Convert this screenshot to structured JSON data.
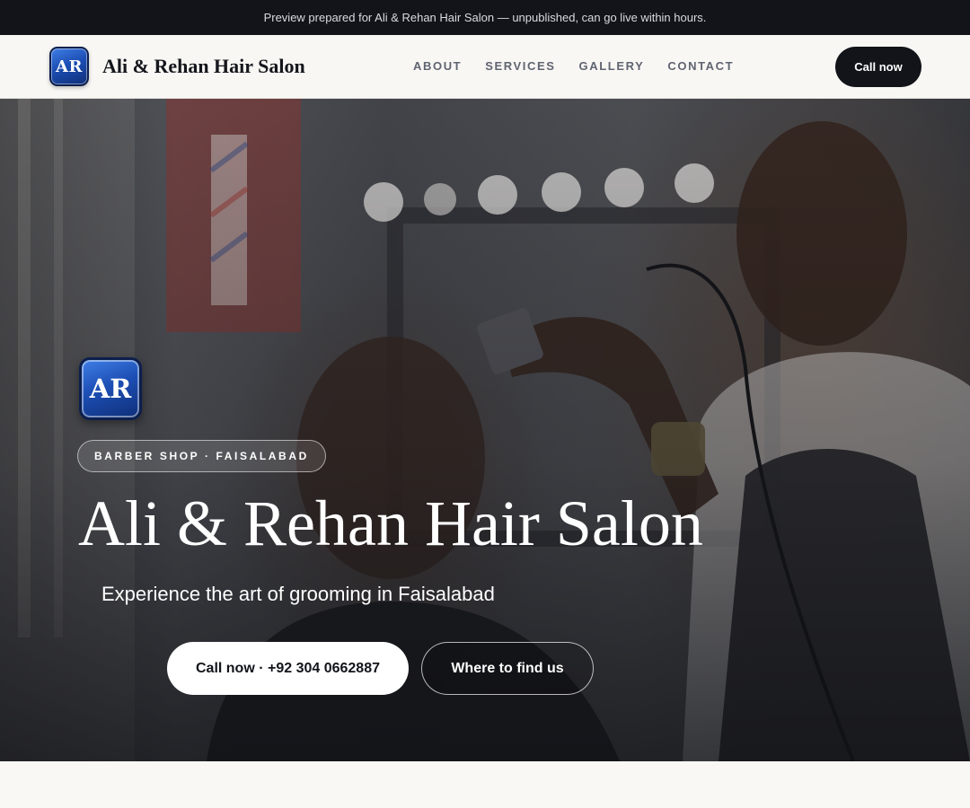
{
  "announcement": "Preview prepared for Ali & Rehan Hair Salon — unpublished, can go live within hours.",
  "header": {
    "logo_initials": "AR",
    "brand_name": "Ali & Rehan Hair Salon",
    "nav": [
      "ABOUT",
      "SERVICES",
      "GALLERY",
      "CONTACT"
    ],
    "cta_label": "Call now"
  },
  "hero": {
    "logo_initials": "AR",
    "tag": "BARBER SHOP · FAISALABAD",
    "title": "Ali & Rehan Hair Salon",
    "subtitle": "Experience the art of grooming in Faisalabad",
    "primary_button": "Call now · +92 304 0662887",
    "secondary_button": "Where to find us",
    "background_image": "barber-cutting-client-hair-photo"
  },
  "colors": {
    "dark": "#121419",
    "accent_blue": "#1d4fb5",
    "page_bg": "#f8f6f2"
  }
}
